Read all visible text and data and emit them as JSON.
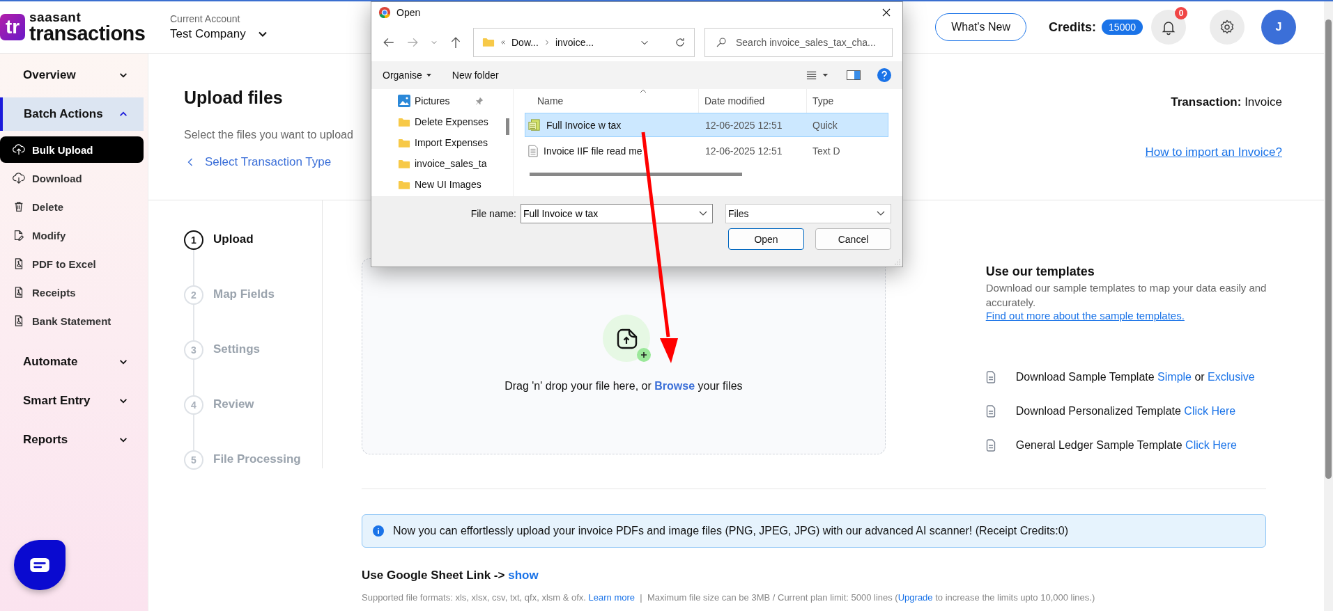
{
  "header": {
    "logo": {
      "mark": "tr",
      "brand": "saasant",
      "product": "transactions"
    },
    "account": {
      "label": "Current Account",
      "value": "Test Company"
    },
    "whats_new": "What's New",
    "credits": {
      "label": "Credits:",
      "value": "15000"
    },
    "notifications": {
      "count": "0"
    },
    "avatar": "J"
  },
  "sidebar": {
    "sections": [
      {
        "label": "Overview",
        "expanded": false,
        "selected": false
      },
      {
        "label": "Batch Actions",
        "expanded": true,
        "selected": true,
        "children": [
          {
            "label": "Bulk Upload",
            "kind": "upload",
            "selected": true
          },
          {
            "label": "Download",
            "kind": "download",
            "selected": false
          },
          {
            "label": "Delete",
            "kind": "delete",
            "selected": false
          },
          {
            "label": "Modify",
            "kind": "modify",
            "selected": false
          },
          {
            "label": "PDF to Excel",
            "kind": "pdf",
            "selected": false
          },
          {
            "label": "Receipts",
            "kind": "pdf",
            "selected": false
          },
          {
            "label": "Bank Statement",
            "kind": "pdf",
            "selected": false
          }
        ]
      },
      {
        "label": "Automate",
        "expanded": false,
        "selected": false
      },
      {
        "label": "Smart Entry",
        "expanded": false,
        "selected": false
      },
      {
        "label": "Reports",
        "expanded": false,
        "selected": false
      }
    ]
  },
  "page": {
    "title": "Upload files",
    "subtitle": "Select the files you want to upload",
    "back_link": "Select Transaction Type",
    "transaction": {
      "label": "Transaction:",
      "value": "Invoice"
    },
    "help_link": "How to import an Invoice?"
  },
  "steps": [
    {
      "number": "1",
      "label": "Upload",
      "selected": true
    },
    {
      "number": "2",
      "label": "Map Fields",
      "selected": false
    },
    {
      "number": "3",
      "label": "Settings",
      "selected": false
    },
    {
      "number": "4",
      "label": "Review",
      "selected": false
    },
    {
      "number": "5",
      "label": "File Processing",
      "selected": false
    }
  ],
  "dropzone": {
    "parts": [
      {
        "text": "Drag 'n' drop your file here, or ",
        "kind": "plain"
      },
      {
        "text": "Browse",
        "kind": "link"
      },
      {
        "text": " your files",
        "kind": "plain"
      }
    ]
  },
  "templates": {
    "title": "Use our templates",
    "description": "Download our sample templates to map your data easily and accurately.",
    "link": "Find out more about the sample templates.",
    "rows": [
      {
        "parts": [
          {
            "text": "Download Sample Template ",
            "kind": "plain"
          },
          {
            "text": "Simple",
            "kind": "link"
          },
          {
            "text": " or ",
            "kind": "plain"
          },
          {
            "text": "Exclusive",
            "kind": "link"
          }
        ]
      },
      {
        "parts": [
          {
            "text": "Download Personalized Template ",
            "kind": "plain"
          },
          {
            "text": "Click Here",
            "kind": "link"
          }
        ]
      },
      {
        "parts": [
          {
            "text": "General Ledger Sample Template ",
            "kind": "plain"
          },
          {
            "text": "Click Here",
            "kind": "link"
          }
        ]
      }
    ]
  },
  "notice": "Now you can effortlessly upload your invoice PDFs and image files (PNG, JPEG, JPG) with our advanced AI scanner! (Receipt Credits:0)",
  "google_sheet": {
    "parts": [
      {
        "text": "Use Google Sheet Link -> ",
        "kind": "plain"
      },
      {
        "text": "show",
        "kind": "link"
      }
    ]
  },
  "supported": {
    "parts": [
      {
        "text": "Supported file formats: xls, xlsx, csv, txt, qfx, xlsm & ofx. ",
        "kind": "plain"
      },
      {
        "text": "Learn more",
        "kind": "link"
      },
      {
        "text": "  |  Maximum file size can be 3MB / Current plan limit: 5000 lines (",
        "kind": "plain"
      },
      {
        "text": "Upgrade",
        "kind": "link"
      },
      {
        "text": " to increase the limits upto 10,000 lines.)",
        "kind": "plain"
      }
    ]
  },
  "dialog": {
    "title": "Open",
    "address": [
      "Dow...",
      "invoice..."
    ],
    "search": {
      "placeholder": "Search invoice_sales_tax_cha..."
    },
    "toolbar": {
      "organise": "Organise",
      "new_folder": "New folder"
    },
    "nav_items": [
      {
        "label": "Pictures",
        "kind": "pictures",
        "pinned": true
      },
      {
        "label": "Delete Expenses",
        "kind": "folder",
        "pinned": false
      },
      {
        "label": "Import Expenses",
        "kind": "folder",
        "pinned": false
      },
      {
        "label": "invoice_sales_ta",
        "kind": "folder",
        "pinned": false
      },
      {
        "label": "New UI Images",
        "kind": "folder",
        "pinned": false
      }
    ],
    "columns": [
      "Name",
      "Date modified",
      "Type"
    ],
    "files": [
      {
        "name": "Full Invoice w tax",
        "kind": "iif",
        "date": "12-06-2025 12:51",
        "type": "Quick",
        "selected": true
      },
      {
        "name": "Invoice IIF file read me",
        "kind": "text",
        "date": "12-06-2025 12:51",
        "type": "Text D",
        "selected": false
      }
    ],
    "file_name": {
      "label": "File name:",
      "value": "Full Invoice w tax"
    },
    "file_type": "Files",
    "buttons": [
      "Open",
      "Cancel"
    ]
  }
}
